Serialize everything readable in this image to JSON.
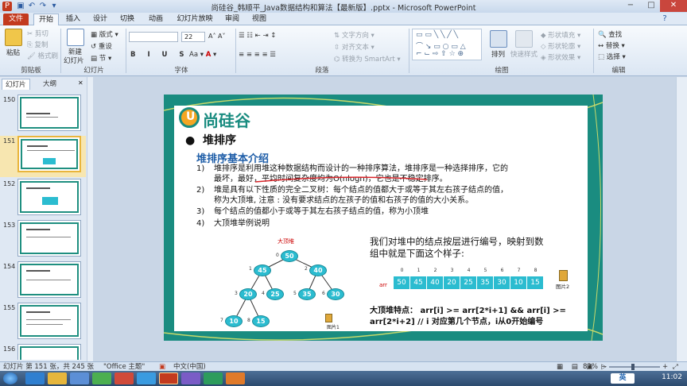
{
  "window": {
    "title": "尚硅谷_韩顺平_Java数据结构和算法【最新版】.pptx - Microsoft PowerPoint",
    "controls": [
      "−",
      "□",
      "✕"
    ]
  },
  "ribbon_tabs": [
    "文件",
    "开始",
    "插入",
    "设计",
    "切换",
    "动画",
    "幻灯片放映",
    "审阅",
    "视图"
  ],
  "ribbon": {
    "clipboard": {
      "paste": "粘贴",
      "cut": "剪切",
      "copy": "复制",
      "format_painter": "格式刷",
      "label": "剪贴板"
    },
    "slides": {
      "new_slide": "新建",
      "new_slide2": "幻灯片",
      "layout": "版式",
      "reset": "重设",
      "section": "节",
      "label": "幻灯片"
    },
    "font": {
      "size": "22",
      "label": "字体"
    },
    "paragraph": {
      "text_direction": "文字方向",
      "align_text": "对齐文本",
      "smartart": "转换为 SmartArt",
      "label": "段落"
    },
    "drawing": {
      "arrange": "排列",
      "quick_styles": "快速样式",
      "shape_fill": "形状填充",
      "shape_outline": "形状轮廓",
      "shape_effects": "形状效果",
      "label": "绘图"
    },
    "editing": {
      "find": "查找",
      "replace": "替换",
      "select": "选择",
      "label": "编辑"
    }
  },
  "left_panel": {
    "tabs": [
      "幻灯片",
      "大纲"
    ],
    "slide_numbers": [
      "150",
      "151",
      "152",
      "153",
      "154",
      "155",
      "156"
    ],
    "selected": "151"
  },
  "slide": {
    "logo_text": "尚硅谷",
    "heading": "堆排序",
    "subheading": "堆排序基本介绍",
    "points": [
      {
        "num": "1)",
        "lines": [
          "堆排序是利用堆这种数据结构而设计的一种排序算法，堆排序是一种选择排序，它的",
          "最坏，最好，平均时间复杂度均为O(nlogn)，它也是不稳定排序。"
        ]
      },
      {
        "num": "2)",
        "lines": [
          "堆是具有以下性质的完全二叉树：每个结点的值都大于或等于其左右孩子结点的值，",
          "称为大顶堆, 注意 : 没有要求结点的左孩子的值和右孩子的值的大小关系。"
        ]
      },
      {
        "num": "3)",
        "lines": [
          "每个结点的值都小于或等于其左右孩子结点的值，称为小顶堆"
        ]
      },
      {
        "num": "4)",
        "lines": [
          "大顶堆举例说明"
        ]
      }
    ],
    "tree_title": "大顶堆",
    "tree_nodes": [
      {
        "index": "0",
        "value": "50"
      },
      {
        "index": "1",
        "value": "45"
      },
      {
        "index": "2",
        "value": "40"
      },
      {
        "index": "3",
        "value": "20"
      },
      {
        "index": "4",
        "value": "25"
      },
      {
        "index": "5",
        "value": "35"
      },
      {
        "index": "6",
        "value": "30"
      },
      {
        "index": "7",
        "value": "10"
      },
      {
        "index": "8",
        "value": "15"
      }
    ],
    "figure1_label": "图片1",
    "explain": [
      "我们对堆中的结点按层进行编号，映射到数",
      "组中就是下面这个样子:"
    ],
    "array_label": "arr",
    "array_indices": [
      "0",
      "1",
      "2",
      "3",
      "4",
      "5",
      "6",
      "7",
      "8"
    ],
    "array_values": [
      "50",
      "45",
      "40",
      "20",
      "25",
      "35",
      "30",
      "10",
      "15"
    ],
    "figure2_label": "图片2",
    "feature": [
      "大顶堆特点： arr[i] >= arr[2*i+1] && arr[i] >=",
      "arr[2*i+2]  // i 对应第几个节点，i从0开始编号"
    ]
  },
  "statusbar": {
    "slide_info": "幻灯片 第 151 张，共 245 张",
    "theme": "\"Office 主题\"",
    "language": "中文(中国)",
    "zoom": "83%"
  },
  "taskbar": {
    "ime": "英",
    "time": "11:02"
  }
}
